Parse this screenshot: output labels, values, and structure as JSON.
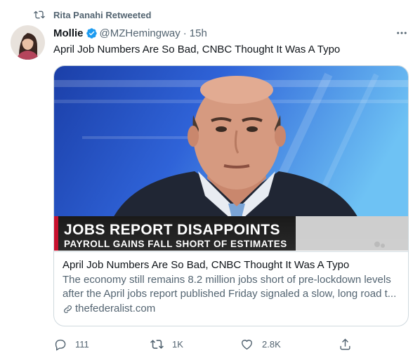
{
  "retweet": {
    "label": "Rita Panahi Retweeted",
    "icon": "retweet-icon"
  },
  "author": {
    "name": "Mollie",
    "handle": "@MZHemingway",
    "separator": "·",
    "time": "15h",
    "verified_color": "#1d9bf0",
    "avatar": "avatar-photo"
  },
  "tweet": {
    "text": "April Job Numbers Are So Bad, CNBC Thought It Was A Typo"
  },
  "card": {
    "chyron_title": "JOBS REPORT DISAPPOINTS",
    "chyron_subtitle": "PAYROLL GAINS FALL SHORT OF ESTIMATES",
    "title": "April Job Numbers Are So Bad, CNBC Thought It Was A Typo",
    "desc_line1": "The economy still remains 8.2 million jobs short of pre-lockdown levels",
    "desc_line2": "after the April jobs report published Friday signaled a slow, long road t...",
    "domain": "thefederalist.com"
  },
  "actions": {
    "replies": "111",
    "retweets": "1K",
    "likes": "2.8K"
  },
  "colors": {
    "text": "#0f1419",
    "secondary": "#536471",
    "border": "#cfd9de",
    "accent": "#1d9bf0",
    "chyron_red": "#c8102e"
  }
}
